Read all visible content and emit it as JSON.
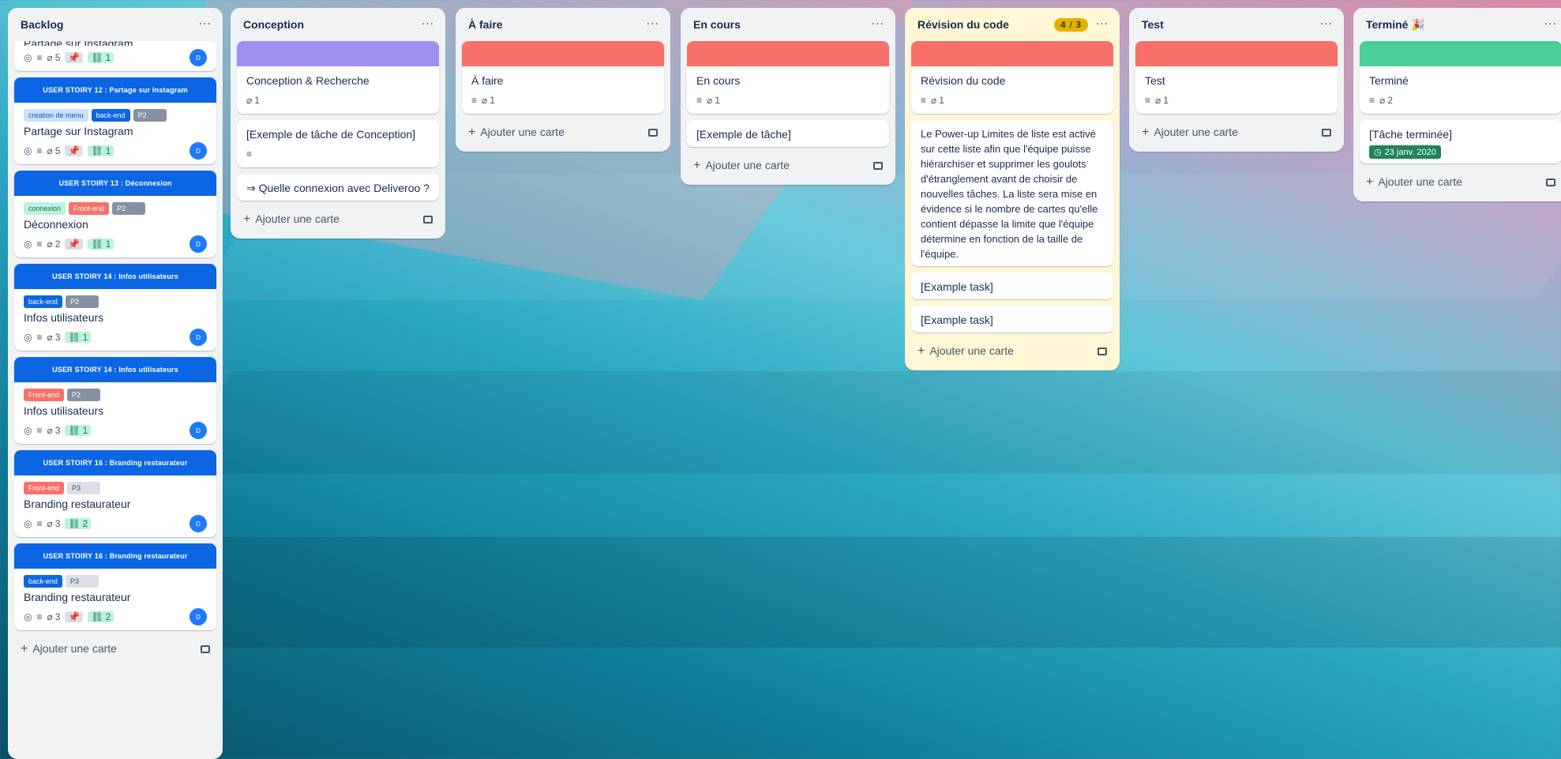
{
  "colors": {
    "purple_cover": "#9f8fef",
    "red_cover": "#f87168",
    "green_cover": "#4bce97",
    "user_story_blue": "#0c66e4"
  },
  "add_card_label": "Ajouter une carte",
  "backlog": {
    "title": "Backlog",
    "menu": "···",
    "clipped_card": {
      "title": "Partage sur Instagram",
      "attachments": "5",
      "checklist": "1",
      "avatar": "D"
    },
    "cards": [
      {
        "cover": "USER STOIRY  12 :  Partage sur Instagram",
        "labels": [
          {
            "text": "creation de menu",
            "bg": "#cce0ff",
            "fg": "#0055cc"
          },
          {
            "text": "back-end",
            "bg": "#0c66e4",
            "fg": "#ffffff"
          },
          {
            "text": "P2",
            "bg": "#8590a2",
            "fg": "#ffffff"
          }
        ],
        "title": "Partage sur Instagram",
        "attachments": "5",
        "checklist": "1",
        "avatar": "D"
      },
      {
        "cover": "USER STOIRY  13 :        Déconnexion",
        "labels": [
          {
            "text": "connexion",
            "bg": "#baf3db",
            "fg": "#216e4e"
          },
          {
            "text": "Front-end",
            "bg": "#f87168",
            "fg": "#ffffff"
          },
          {
            "text": "P2",
            "bg": "#8590a2",
            "fg": "#ffffff"
          }
        ],
        "title": "Déconnexion",
        "attachments": "2",
        "checklist": "1",
        "avatar": "D"
      },
      {
        "cover": "USER STOIRY  14 :    Infos utilisateurs",
        "labels": [
          {
            "text": "back-end",
            "bg": "#0c66e4",
            "fg": "#ffffff"
          },
          {
            "text": "P2",
            "bg": "#8590a2",
            "fg": "#ffffff"
          }
        ],
        "title": "Infos utilisateurs",
        "attachments": "3",
        "checklist": "1",
        "avatar": "D"
      },
      {
        "cover": "USER STOIRY  14 :    Infos utilisateurs",
        "labels": [
          {
            "text": "Front-end",
            "bg": "#f87168",
            "fg": "#ffffff"
          },
          {
            "text": "P2",
            "bg": "#8590a2",
            "fg": "#ffffff"
          }
        ],
        "title": "Infos utilisateurs",
        "attachments": "3",
        "checklist": "1",
        "avatar": "D"
      },
      {
        "cover": "USER STOIRY  16 :    Branding restaurateur",
        "labels": [
          {
            "text": "Front-end",
            "bg": "#f87168",
            "fg": "#ffffff"
          },
          {
            "text": "P3",
            "bg": "#dcdfe4",
            "fg": "#44546f"
          }
        ],
        "title": "Branding restaurateur",
        "attachments": "3",
        "checklist": "2",
        "avatar": "D"
      },
      {
        "cover": "USER STOIRY  16 :    Branding restaurateur",
        "labels": [
          {
            "text": "back-end",
            "bg": "#0c66e4",
            "fg": "#ffffff"
          },
          {
            "text": "P3",
            "bg": "#dcdfe4",
            "fg": "#44546f"
          }
        ],
        "title": "Branding restaurateur",
        "attachments": "3",
        "checklist": "2",
        "avatar": "D"
      }
    ]
  },
  "lists": [
    {
      "title": "Conception",
      "cover": "#9f8fef",
      "cards": [
        {
          "title": "Conception & Recherche",
          "attachments": "1",
          "desc": false
        },
        {
          "title": "[Exemple de tâche de Conception]",
          "desc": true
        },
        {
          "title": "⇒ Quelle connexion avec Deliveroo ?"
        }
      ]
    },
    {
      "title": "À faire",
      "cover": "#f87168",
      "cards": [
        {
          "title": "À faire",
          "attachments": "1",
          "desc": true
        }
      ]
    },
    {
      "title": "En cours",
      "cover": "#f87168",
      "cards": [
        {
          "title": "En cours",
          "attachments": "1",
          "desc": true
        },
        {
          "title": "[Exemple de tâche]"
        }
      ]
    },
    {
      "title": "Révision du code",
      "cover": "#f87168",
      "limit": "4 / 3",
      "cards": [
        {
          "title": "Révision du code",
          "attachments": "1",
          "desc": true
        },
        {
          "title": "Le Power-up Limites de liste est activé sur cette liste afin que l'équipe puisse hiérarchiser et supprimer les goulots d'étranglement avant de choisir de nouvelles tâches. La liste sera mise en évidence si le nombre de cartes qu'elle contient dépasse la limite que l'équipe détermine en fonction de la taille de l'équipe."
        },
        {
          "title": "[Example task]"
        },
        {
          "title": "[Example task]"
        }
      ]
    },
    {
      "title": "Test",
      "cover": "#f87168",
      "cards": [
        {
          "title": "Test",
          "attachments": "1",
          "desc": true
        }
      ]
    },
    {
      "title": "Terminé 🎉",
      "cover": "#4bce97",
      "cards": [
        {
          "title": "Terminé",
          "attachments": "2",
          "desc": true
        },
        {
          "title": "[Tâche terminée]",
          "due": "23 janv. 2020"
        }
      ]
    }
  ]
}
